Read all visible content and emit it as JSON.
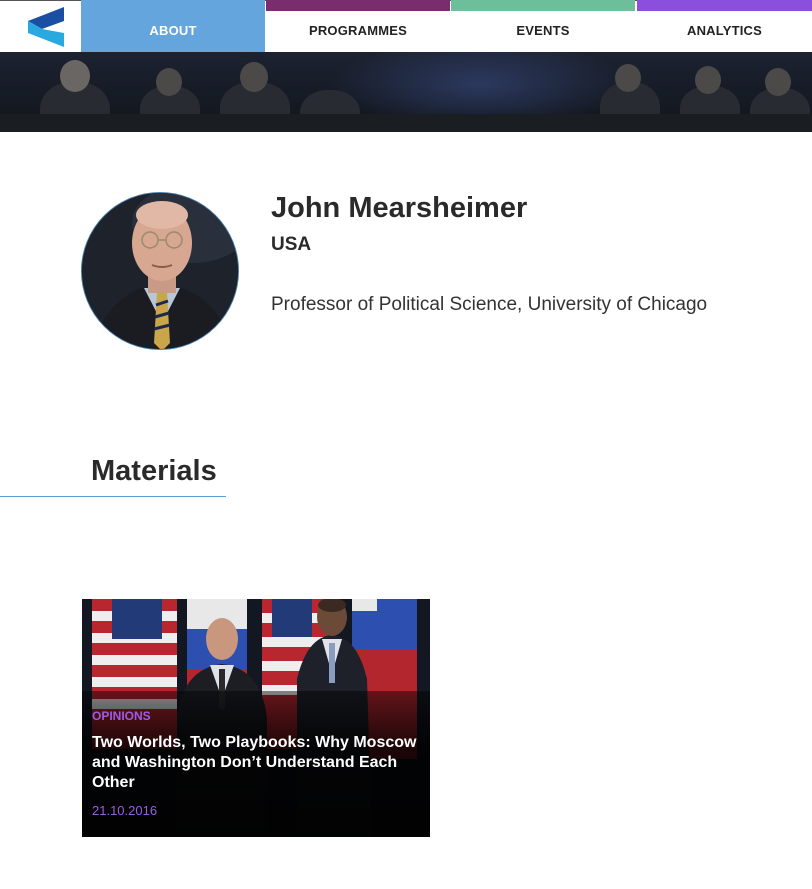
{
  "brand": {
    "logo_icon": "chevron-logo-icon",
    "logo_colors": [
      "#1a4fa3",
      "#2aa8e0"
    ]
  },
  "nav": {
    "items": [
      {
        "label": "ABOUT",
        "accent": "#65a5dd",
        "active": true
      },
      {
        "label": "PROGRAMMES",
        "accent": "#7a2d6e",
        "active": false
      },
      {
        "label": "EVENTS",
        "accent": "#6cbf9a",
        "active": false
      },
      {
        "label": "ANALYTICS",
        "accent": "#8a4fdc",
        "active": false
      }
    ]
  },
  "profile": {
    "name": "John Mearsheimer",
    "country": "USA",
    "position": "Professor of Political Science, University of Chicago"
  },
  "materials": {
    "title": "Materials",
    "cards": [
      {
        "category": "OPINIONS",
        "title": "Two Worlds, Two Playbooks: Why Moscow and Washington Don’t Understand Each Other",
        "date": "21.10.2016"
      }
    ]
  },
  "colors": {
    "accent_purple": "#9b5de5",
    "underline_blue": "#5a9fd0"
  }
}
